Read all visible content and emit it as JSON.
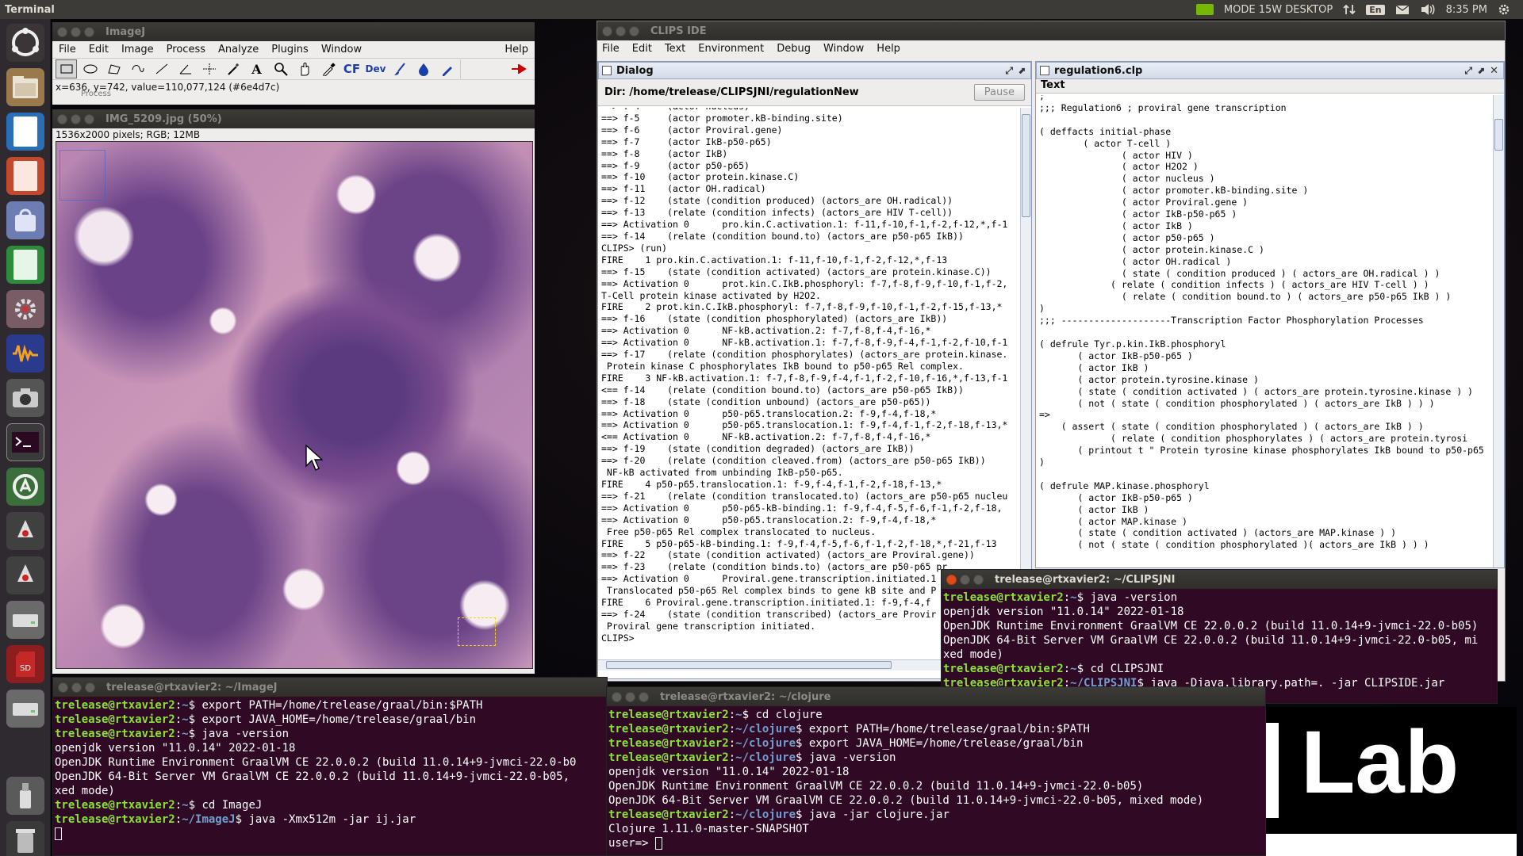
{
  "topbar": {
    "app_name": "Terminal",
    "indicator_label": "MODE 15W DESKTOP",
    "lang": "En",
    "time": "8:35 PM"
  },
  "launcher": {
    "items": [
      "ubuntu-dash",
      "files",
      "libreoffice-writer",
      "libreoffice-impress",
      "software-center",
      "libreoffice-calc",
      "system-settings",
      "audacity",
      "screenshot",
      "terminal",
      "software-updater",
      "java-app",
      "java-app-2",
      "drive",
      "sd-card",
      "drive-2",
      "usb-drive",
      "trash"
    ]
  },
  "imagej": {
    "title": "ImageJ",
    "menus": [
      "File",
      "Edit",
      "Image",
      "Process",
      "Analyze",
      "Plugins",
      "Window",
      "Help"
    ],
    "tool_labels": {
      "cf": "CF",
      "dev": "Dev"
    },
    "status": "x=636, y=742, value=110,077,124 (#6e4d7c)",
    "status_behind": "Process"
  },
  "image_window": {
    "title": "IMG_5209.jpg (50%)",
    "info": "1536x2000 pixels; RGB; 12MB"
  },
  "clips": {
    "title": "CLIPS IDE",
    "menus": [
      "File",
      "Edit",
      "Text",
      "Environment",
      "Debug",
      "Window",
      "Help"
    ],
    "dialog": {
      "title": "Dialog",
      "dir": "Dir: /home/trelease/CLIPSJNI/regulationNew",
      "pause": "Pause",
      "lines": [
        "==> f-4     (actor nucleus)",
        "==> f-5     (actor promoter.kB-binding.site)",
        "==> f-6     (actor Proviral.gene)",
        "==> f-7     (actor IkB-p50-p65)",
        "==> f-8     (actor IkB)",
        "==> f-9     (actor p50-p65)",
        "==> f-10    (actor protein.kinase.C)",
        "==> f-11    (actor OH.radical)",
        "==> f-12    (state (condition produced) (actors_are OH.radical))",
        "==> f-13    (relate (condition infects) (actors_are HIV T-cell))",
        "==> Activation 0      pro.kin.C.activation.1: f-11,f-10,f-1,f-2,f-12,*,f-1",
        "==> f-14    (relate (condition bound.to) (actors_are p50-p65 IkB))",
        "CLIPS> (run)",
        "FIRE    1 pro.kin.C.activation.1: f-11,f-10,f-1,f-2,f-12,*,f-13",
        "==> f-15    (state (condition activated) (actors_are protein.kinase.C))",
        "==> Activation 0      prot.kin.C.IkB.phosphoryl: f-7,f-8,f-9,f-10,f-1,f-2,",
        "T-Cell protein kinase activated by H2O2.",
        "FIRE    2 prot.kin.C.IkB.phosphoryl: f-7,f-8,f-9,f-10,f-1,f-2,f-15,f-13,*",
        "==> f-16    (state (condition phosphorylated) (actors_are IkB))",
        "==> Activation 0      NF-kB.activation.2: f-7,f-8,f-4,f-16,*",
        "==> Activation 0      NF-kB.activation.1: f-7,f-8,f-9,f-4,f-1,f-2,f-10,f-1",
        "==> f-17    (relate (condition phosphorylates) (actors_are protein.kinase.",
        " Protein kinase C phosphorylates IkB bound to p50-p65 Rel complex.",
        "FIRE    3 NF-kB.activation.1: f-7,f-8,f-9,f-4,f-1,f-2,f-10,f-16,*,f-13,f-1",
        "<== f-14    (relate (condition bound.to) (actors_are p50-p65 IkB))",
        "==> f-18    (state (condition unbound) (actors_are p50-p65))",
        "==> Activation 0      p50-p65.translocation.2: f-9,f-4,f-18,*",
        "==> Activation 0      p50-p65.translocation.1: f-9,f-4,f-1,f-2,f-18,f-13,*",
        "<== Activation 0      NF-kB.activation.2: f-7,f-8,f-4,f-16,*",
        "==> f-19    (state (condition degraded) (actors_are IkB))",
        "==> f-20    (relate (condition cleaved.from) (actors_are p50-p65 IkB))",
        " NF-kB activated from unbinding IkB-p50-p65.",
        "FIRE    4 p50-p65.translocation.1: f-9,f-4,f-1,f-2,f-18,f-13,*",
        "==> f-21    (relate (condition translocated.to) (actors_are p50-p65 nucleu",
        "==> Activation 0      p50-p65-kB-binding.1: f-9,f-4,f-5,f-6,f-1,f-2,f-18,",
        "==> Activation 0      p50-p65.translocation.2: f-9,f-4,f-18,*",
        " Free p50-p65 Rel complex translocated to nucleus.",
        "FIRE    5 p50-p65-kB-binding.1: f-9,f-4,f-5,f-6,f-1,f-2,f-18,*,f-21,f-13",
        "==> f-22    (state (condition activated) (actors_are Proviral.gene))",
        "==> f-23    (relate (condition binds.to) (actors_are p50-p65 pr",
        "==> Activation 0      Proviral.gene.transcription.initiated.1",
        " Translocated p50-p65 Rel complex binds to gene kB site and P",
        "FIRE    6 Proviral.gene.transcription.initiated.1: f-9,f-4,f",
        "==> f-24    (state (condition transcribed) (actors_are Provir",
        " Proviral gene transcription initiated.",
        "CLIPS> "
      ]
    },
    "editor": {
      "title": "regulation6.clp",
      "tab": "Text",
      "lines": [
        ";",
        ";;; Regulation6 ; proviral gene transcription",
        "",
        "( deffacts initial-phase",
        "        ( actor T-cell )",
        "               ( actor HIV )",
        "               ( actor H2O2 )",
        "               ( actor nucleus )",
        "               ( actor promoter.kB-binding.site )",
        "               ( actor Proviral.gene )",
        "               ( actor IkB-p50-p65 )",
        "               ( actor IkB )",
        "               ( actor p50-p65 )",
        "               ( actor protein.kinase.C )",
        "               ( actor OH.radical )",
        "               ( state ( condition produced ) ( actors_are OH.radical ) )",
        "             ( relate ( condition infects ) ( actors_are HIV T-cell ) )",
        "               ( relate ( condition bound.to ) ( actors_are p50-p65 IkB ) )",
        ")",
        ";;; --------------------Transcription Factor Phosphorylation Processes",
        "",
        "( defrule Tyr.p.kin.IkB.phosphoryl",
        "       ( actor IkB-p50-p65 )",
        "       ( actor IkB )",
        "       ( actor protein.tyrosine.kinase )",
        "       ( state ( condition activated ) ( actors_are protein.tyrosine.kinase ) )",
        "       ( not ( state ( condition phosphorylated ) ( actors_are IkB ) ) )",
        "=>",
        "    ( assert ( state ( condition phosphorylated ) ( actors_are IkB ) )",
        "             ( relate ( condition phosphorylates ) ( actors_are protein.tyrosi",
        "       ( printout t \" Protein tyrosine kinase phosphorylates IkB bound to p50-p65",
        ")",
        "",
        "( defrule MAP.kinase.phosphoryl",
        "       ( actor IkB-p50-p65 )",
        "       ( actor IkB )",
        "       ( actor MAP.kinase )",
        "       ( state ( condition activated ) (actors_are MAP.kinase ) )",
        "       ( not ( state ( condition phosphorylated )( actors_are IkB ) ) )"
      ]
    }
  },
  "term_clipsjni": {
    "title": "trelease@rtxavier2: ~/CLIPSJNI",
    "lines": [
      {
        "p": "trelease@rtxavier2",
        "path": "~",
        "t": "$ java -version"
      },
      {
        "t": "openjdk version \"11.0.14\" 2022-01-18"
      },
      {
        "t": "OpenJDK Runtime Environment GraalVM CE 22.0.0.2 (build 11.0.14+9-jvmci-22.0-b05)"
      },
      {
        "t": "OpenJDK 64-Bit Server VM GraalVM CE 22.0.0.2 (build 11.0.14+9-jvmci-22.0-b05, mi"
      },
      {
        "t": "xed mode)"
      },
      {
        "p": "trelease@rtxavier2",
        "path": "~",
        "t": "$ cd CLIPSJNI"
      },
      {
        "p": "trelease@rtxavier2",
        "path": "~/CLIPSJNI",
        "t": "$ java -Djava.library.path=. -jar CLIPSIDE.jar"
      }
    ]
  },
  "term_imagej": {
    "title": "trelease@rtxavier2: ~/ImageJ",
    "lines": [
      {
        "p": "trelease@rtxavier2",
        "path": "~",
        "t": "$ export PATH=/home/trelease/graal/bin:$PATH"
      },
      {
        "p": "trelease@rtxavier2",
        "path": "~",
        "t": "$ export JAVA_HOME=/home/trelease/graal/bin"
      },
      {
        "p": "trelease@rtxavier2",
        "path": "~",
        "t": "$ java -version"
      },
      {
        "t": "openjdk version \"11.0.14\" 2022-01-18"
      },
      {
        "t": "OpenJDK Runtime Environment GraalVM CE 22.0.0.2 (build 11.0.14+9-jvmci-22.0-b0"
      },
      {
        "t": "OpenJDK 64-Bit Server VM GraalVM CE 22.0.0.2 (build 11.0.14+9-jvmci-22.0-b05,"
      },
      {
        "t": "xed mode)"
      },
      {
        "p": "trelease@rtxavier2",
        "path": "~",
        "t": "$ cd ImageJ"
      },
      {
        "p": "trelease@rtxavier2",
        "path": "~/ImageJ",
        "t": "$ java -Xmx512m -jar ij.jar"
      }
    ]
  },
  "term_clojure": {
    "title": "trelease@rtxavier2: ~/clojure",
    "lines": [
      {
        "p": "trelease@rtxavier2",
        "path": "~",
        "t": "$ cd clojure"
      },
      {
        "p": "trelease@rtxavier2",
        "path": "~/clojure",
        "t": "$ export PATH=/home/trelease/graal/bin:$PATH"
      },
      {
        "p": "trelease@rtxavier2",
        "path": "~/clojure",
        "t": "$ export JAVA_HOME=/home/trelease/graal/bin"
      },
      {
        "p": "trelease@rtxavier2",
        "path": "~/clojure",
        "t": "$ java -version"
      },
      {
        "t": "openjdk version \"11.0.14\" 2022-01-18"
      },
      {
        "t": "OpenJDK Runtime Environment GraalVM CE 22.0.0.2 (build 11.0.14+9-jvmci-22.0-b05)"
      },
      {
        "t": "OpenJDK 64-Bit Server VM GraalVM CE 22.0.0.2 (build 11.0.14+9-jvmci-22.0-b05, mixed mode)"
      },
      {
        "p": "trelease@rtxavier2",
        "path": "~/clojure",
        "t": "$ java -jar clojure.jar"
      },
      {
        "t": "Clojure 1.11.0-master-SNAPSHOT"
      },
      {
        "t": "user=> ",
        "cursor": true
      }
    ]
  },
  "ai_lab_logo": {
    "text": "Lab"
  }
}
